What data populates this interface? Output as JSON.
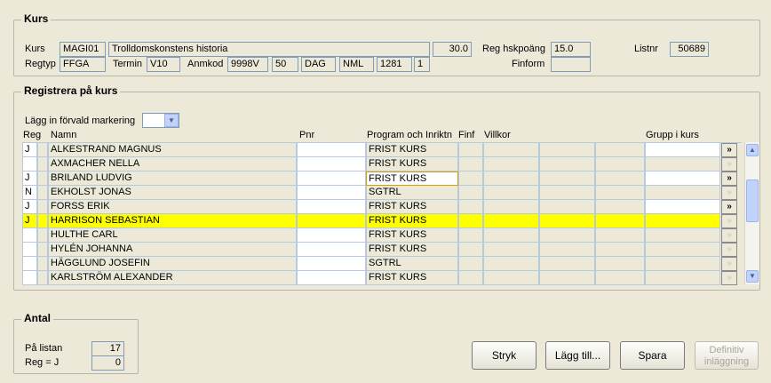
{
  "kurs": {
    "title": "Kurs",
    "kurs_label": "Kurs",
    "kurs_code": "MAGI01",
    "kurs_name": "Trolldomskonstens historia",
    "hp": "30.0",
    "reg_hsk_label": "Reg hskpoäng",
    "reg_hsk_value": "15.0",
    "listnr_label": "Listnr",
    "listnr_value": "50689",
    "regtyp_label": "Regtyp",
    "regtyp_value": "FFGA",
    "termin_label": "Termin",
    "termin_value": "V10",
    "anmkod_label": "Anmkod",
    "anmkod_1": "9998V",
    "anmkod_2": "50",
    "anmkod_3": "DAG",
    "anmkod_4": "NML",
    "anmkod_5": "1281",
    "anmkod_6": "1",
    "finform_label": "Finform",
    "finform_value": ""
  },
  "register": {
    "title": "Registrera på kurs",
    "default_mark_label": "Lägg in förvald markering",
    "default_mark_value": "",
    "columns": {
      "reg": "Reg",
      "namn": "Namn",
      "pnr": "Pnr",
      "program": "Program och Inriktn",
      "finf": "Finf",
      "villkor": "Villkor",
      "grupp": "Grupp i kurs"
    },
    "rows": [
      {
        "reg": "J",
        "namn": "ALKESTRAND MAGNUS",
        "program": "FRIST KURS",
        "grupp_white": true,
        "btn": "»",
        "btn_enabled": true
      },
      {
        "reg": "",
        "namn": "AXMACHER NELLA",
        "program": "FRIST KURS",
        "grupp_white": false,
        "btn": "»",
        "btn_enabled": false
      },
      {
        "reg": "J",
        "namn": "BRILAND LUDVIG",
        "program": "FRIST KURS",
        "grupp_white": true,
        "btn": "»",
        "btn_enabled": true
      },
      {
        "reg": "N",
        "namn": "EKHOLST JONAS",
        "program": "SGTRL",
        "grupp_white": false,
        "btn": "»",
        "btn_enabled": false
      },
      {
        "reg": "J",
        "namn": "FORSS ERIK",
        "program": "FRIST KURS",
        "grupp_white": true,
        "btn": "»",
        "btn_enabled": true
      },
      {
        "reg": "J",
        "namn": "HARRISON SEBASTIAN",
        "program": "FRIST KURS",
        "grupp_white": false,
        "btn": "»",
        "btn_enabled": false,
        "highlight": true
      },
      {
        "reg": "",
        "namn": "HULTHE CARL",
        "program": "FRIST KURS",
        "grupp_white": false,
        "btn": "»",
        "btn_enabled": false
      },
      {
        "reg": "",
        "namn": "HYLÉN JOHANNA",
        "program": "FRIST KURS",
        "grupp_white": false,
        "btn": "»",
        "btn_enabled": false
      },
      {
        "reg": "",
        "namn": "HÄGGLUND JOSEFIN",
        "program": "SGTRL",
        "grupp_white": false,
        "btn": "»",
        "btn_enabled": false
      },
      {
        "reg": "",
        "namn": "KARLSTRÖM ALEXANDER",
        "program": "FRIST KURS",
        "grupp_white": false,
        "btn": "»",
        "btn_enabled": false
      }
    ],
    "scrollbar": {
      "up": "▲",
      "down": "▼"
    }
  },
  "antal": {
    "title": "Antal",
    "pa_listan_label": "På listan",
    "pa_listan_value": "17",
    "reg_j_label": "Reg = J",
    "reg_j_value": "0"
  },
  "buttons": {
    "stryk": "Stryk",
    "lagg_till": "Lägg till...",
    "spara": "Spara",
    "definitiv_line1": "Definitiv",
    "definitiv_line2": "inläggning"
  },
  "colors": {
    "highlight": "#ffff00",
    "window_bg": "#ece9d8"
  }
}
